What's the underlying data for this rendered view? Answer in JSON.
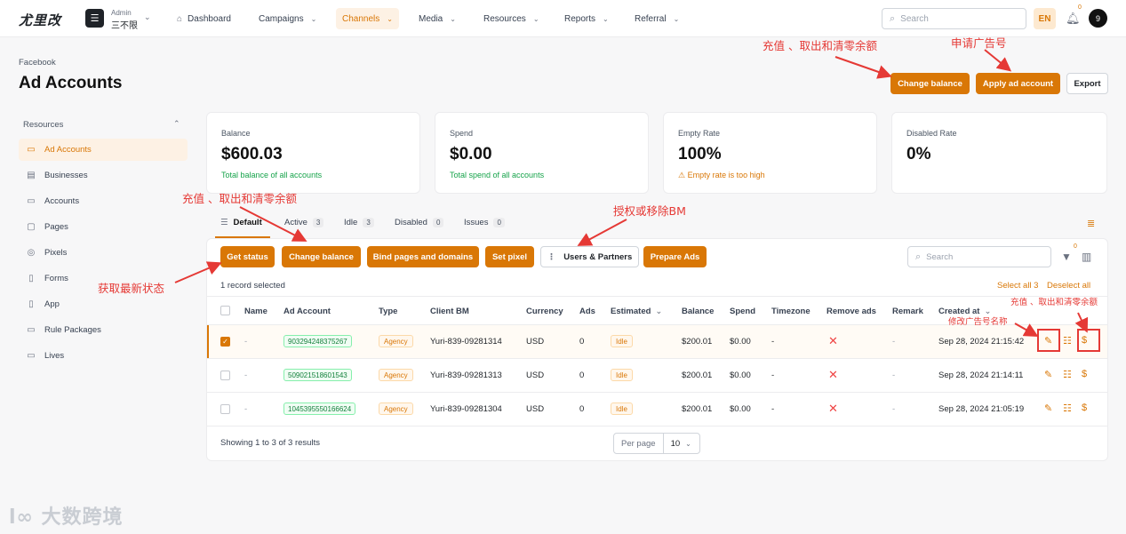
{
  "app": {
    "logo": "尤里改",
    "workspace_role": "Admin",
    "workspace_name": "三不限",
    "lang": "EN",
    "notif_count": "0",
    "avatar": "9"
  },
  "nav": [
    "Dashboard",
    "Campaigns",
    "Channels",
    "Media",
    "Resources",
    "Reports",
    "Referral"
  ],
  "top_search_placeholder": "Search",
  "header": {
    "breadcrumb": "Facebook",
    "title": "Ad Accounts"
  },
  "header_buttons": {
    "change_balance": "Change balance",
    "apply_ad_account": "Apply ad account",
    "export": "Export"
  },
  "sidebar": {
    "section": "Resources",
    "items": [
      "Ad Accounts",
      "Businesses",
      "Accounts",
      "Pages",
      "Pixels",
      "Forms",
      "App",
      "Rule Packages",
      "Lives"
    ]
  },
  "stats": [
    {
      "label": "Balance",
      "value": "$600.03",
      "sub": "Total balance of all accounts"
    },
    {
      "label": "Spend",
      "value": "$0.00",
      "sub": "Total spend of all accounts"
    },
    {
      "label": "Empty Rate",
      "value": "100%",
      "sub": "Empty rate is too high"
    },
    {
      "label": "Disabled Rate",
      "value": "0%",
      "sub": ""
    }
  ],
  "tabs": [
    {
      "label": "Default",
      "count": ""
    },
    {
      "label": "Active",
      "count": "3"
    },
    {
      "label": "Idle",
      "count": "3"
    },
    {
      "label": "Disabled",
      "count": "0"
    },
    {
      "label": "Issues",
      "count": "0"
    }
  ],
  "toolbar": {
    "get_status": "Get status",
    "change_balance": "Change balance",
    "bind_pages": "Bind pages and domains",
    "set_pixel": "Set pixel",
    "users_partners": "Users & Partners",
    "prepare_ads": "Prepare Ads",
    "search_placeholder": "Search",
    "filter_count": "0"
  },
  "selection": {
    "selected_text": "1 record selected",
    "select_all": "Select all 3",
    "deselect_all": "Deselect all"
  },
  "table": {
    "columns": [
      "Name",
      "Ad Account",
      "Type",
      "Client BM",
      "Currency",
      "Ads",
      "Estimated",
      "Balance",
      "Spend",
      "Timezone",
      "Remove ads",
      "Remark",
      "Created at"
    ],
    "rows": [
      {
        "checked": true,
        "name": "-",
        "ad_account": "903294248375267",
        "type": "Agency",
        "client_bm": "Yuri-839-09281314",
        "currency": "USD",
        "ads": "0",
        "estimated": "Idle",
        "balance": "$200.01",
        "spend": "$0.00",
        "timezone": "-",
        "remark": "-",
        "created_at": "Sep 28, 2024 21:15:42"
      },
      {
        "checked": false,
        "name": "-",
        "ad_account": "509021518601543",
        "type": "Agency",
        "client_bm": "Yuri-839-09281313",
        "currency": "USD",
        "ads": "0",
        "estimated": "Idle",
        "balance": "$200.01",
        "spend": "$0.00",
        "timezone": "-",
        "remark": "-",
        "created_at": "Sep 28, 2024 21:14:11"
      },
      {
        "checked": false,
        "name": "-",
        "ad_account": "1045395550166624",
        "type": "Agency",
        "client_bm": "Yuri-839-09281304",
        "currency": "USD",
        "ads": "0",
        "estimated": "Idle",
        "balance": "$200.01",
        "spend": "$0.00",
        "timezone": "-",
        "remark": "-",
        "created_at": "Sep 28, 2024 21:05:19"
      }
    ]
  },
  "pagination": {
    "summary": "Showing 1 to 3 of 3 results",
    "per_page_label": "Per page",
    "per_page": "10"
  },
  "annotations": {
    "header_change_balance": "充值 、取出和清零余额",
    "header_apply": "申请广告号",
    "toolbar_change_balance": "充值 、取出和清零余额",
    "toolbar_users": "授权或移除BM",
    "toolbar_get_status": "获取最新状态",
    "row_edit_name": "修改广告号名称",
    "row_balance": "充值 、取出和清零余额"
  },
  "watermark": "大数跨境",
  "colors": {
    "accent": "#d97706",
    "annotation": "#e53935",
    "success": "#16a34a",
    "danger": "#ef4444"
  }
}
